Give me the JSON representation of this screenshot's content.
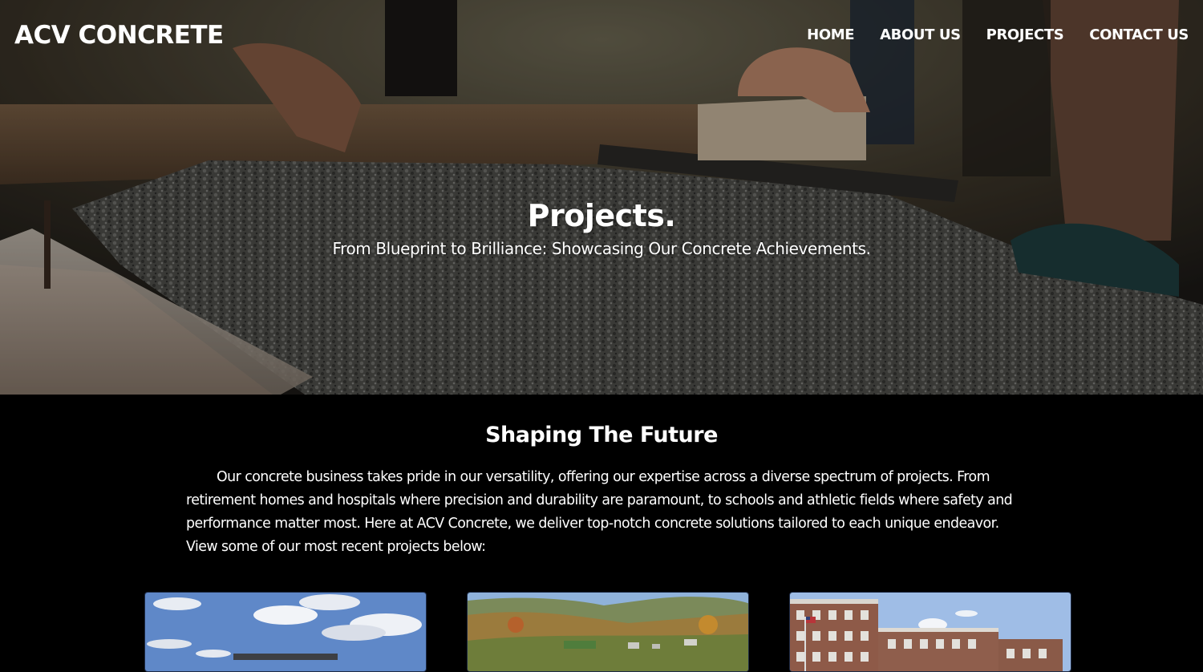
{
  "header": {
    "logo": "ACV CONCRETE",
    "nav": [
      "HOME",
      "ABOUT US",
      "PROJECTS",
      "CONTACT US"
    ]
  },
  "hero": {
    "title": "Projects.",
    "subtitle": "From Blueprint to Brilliance: Showcasing Our Concrete Achievements."
  },
  "intro": {
    "heading": "Shaping The Future",
    "body": "Our concrete business takes pride in our versatility, offering our expertise across a diverse spectrum of projects. From retirement homes and hospitals where precision and durability are paramount, to schools and athletic fields where safety and performance matter most. Here at ACV Concrete, we deliver top-notch concrete solutions tailored to each unique endeavor. View some of our most recent projects below:"
  },
  "projects": [
    {
      "image": "building-under-cloudy-sky"
    },
    {
      "image": "valley-town-autumn-aerial"
    },
    {
      "image": "brick-retirement-home-with-flag"
    }
  ],
  "colors": {
    "page_background": "#000000",
    "text": "#ffffff"
  }
}
